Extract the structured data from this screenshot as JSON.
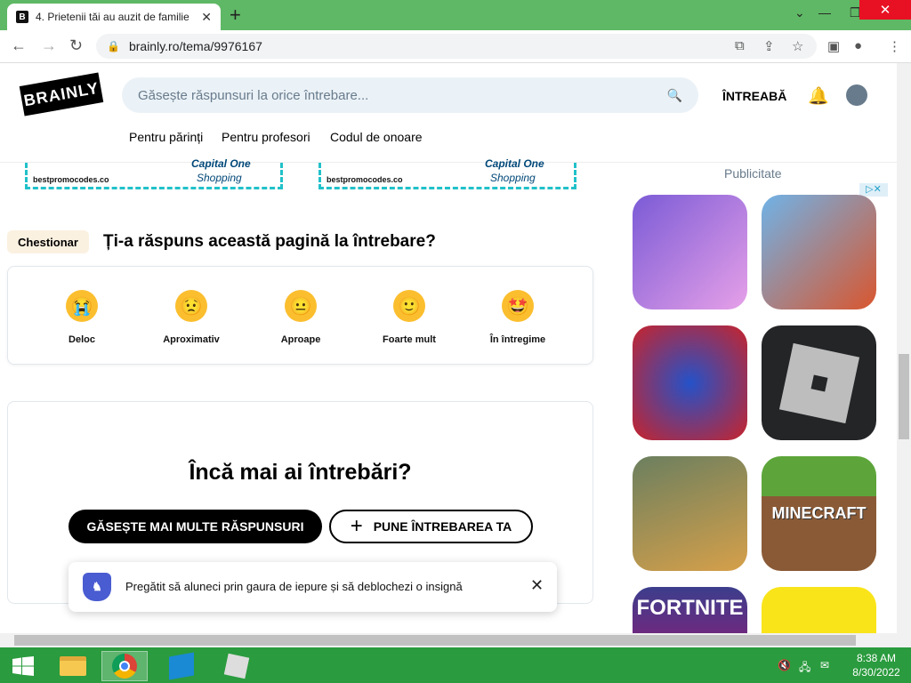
{
  "browser": {
    "tab_title": "4. Prietenii tăi au auzit de familie",
    "tab_favicon": "B",
    "url": "brainly.ro/tema/9976167"
  },
  "header": {
    "logo": "BRAINLY",
    "search_placeholder": "Găsește răspunsuri la orice întrebare...",
    "ask_label": "ÎNTREABĂ",
    "nav": [
      "Pentru părinți",
      "Pentru profesori",
      "Codul de onoare"
    ]
  },
  "ads": {
    "promo_text": "bestpromocodes.co",
    "brand_text": "Capital One",
    "shop_text": "Shopping",
    "sidebar_label": "Publicitate",
    "sidebar_games": [
      "",
      "",
      "",
      "",
      "",
      "MINECRAFT",
      "FORTNITE",
      ""
    ]
  },
  "poll": {
    "badge": "Chestionar",
    "question": "Ți-a răspuns această pagină la întrebare?",
    "options": [
      {
        "label": "Deloc",
        "emoji": "😭"
      },
      {
        "label": "Aproximativ",
        "emoji": "😟"
      },
      {
        "label": "Aproape",
        "emoji": "😐"
      },
      {
        "label": "Foarte mult",
        "emoji": "🙂"
      },
      {
        "label": "În întregime",
        "emoji": "🤩"
      }
    ]
  },
  "more": {
    "title": "Încă mai ai întrebări?",
    "find_button": "GĂSEȘTE MAI MULTE RĂSPUNSURI",
    "ask_button": "PUNE ÎNTREBAREA TA"
  },
  "toast": {
    "message": "Pregătit să aluneci prin gaura de iepure și să deblochezi o insignă"
  },
  "taskbar": {
    "time": "8:38 AM",
    "date": "8/30/2022"
  },
  "colors": {
    "accent_teal": "#21c1c9",
    "taskbar": "#2a9b3e",
    "tabstrip": "#5fb865"
  }
}
